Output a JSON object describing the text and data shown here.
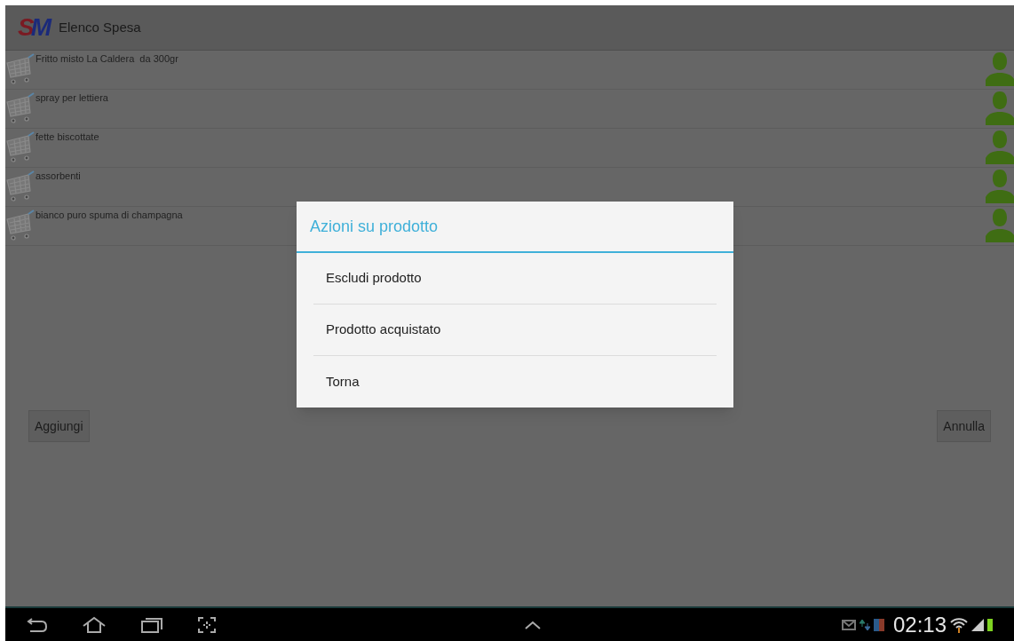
{
  "action_bar": {
    "logo": "SM",
    "title": "Elenco Spesa"
  },
  "items": [
    {
      "name": "Fritto misto La Caldera  da 300gr"
    },
    {
      "name": "spray per lettiera"
    },
    {
      "name": "fette biscottate"
    },
    {
      "name": "assorbenti"
    },
    {
      "name": "bianco puro spuma di champagna"
    }
  ],
  "buttons": [
    "Aggiungi",
    "Annulla"
  ],
  "dialog": {
    "title": "Azioni su prodotto",
    "options": [
      "Escludi prodotto",
      "Prodotto acquistato",
      "Torna"
    ]
  },
  "status_bar": {
    "time": "02:13"
  }
}
